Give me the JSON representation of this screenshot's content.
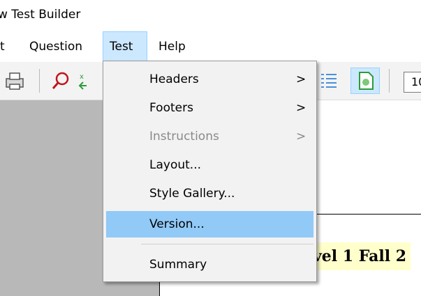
{
  "window": {
    "title": "w Test Builder"
  },
  "menubar": {
    "items": [
      {
        "label": "t"
      },
      {
        "label": "Question"
      },
      {
        "label": "Test"
      },
      {
        "label": "Help"
      }
    ]
  },
  "toolbar": {
    "icons": [
      "print-icon",
      "search-icon",
      "swap-icon",
      "list-icon",
      "page-view-icon"
    ],
    "zoom_value": "10"
  },
  "test_menu": {
    "items": [
      {
        "label": "Headers",
        "arrow": ">"
      },
      {
        "label": "Footers",
        "arrow": ">"
      },
      {
        "label": "Instructions",
        "arrow": ">"
      },
      {
        "label": "Layout..."
      },
      {
        "label": "Style Gallery..."
      },
      {
        "label": "Version..."
      },
      {
        "label": "Summary"
      }
    ]
  },
  "document": {
    "heading_visible": "vel 1 Fall 2"
  },
  "colors": {
    "highlight": "#91c9f7",
    "active_menu": "#cce8ff",
    "heading_bg": "#ffffcc"
  }
}
